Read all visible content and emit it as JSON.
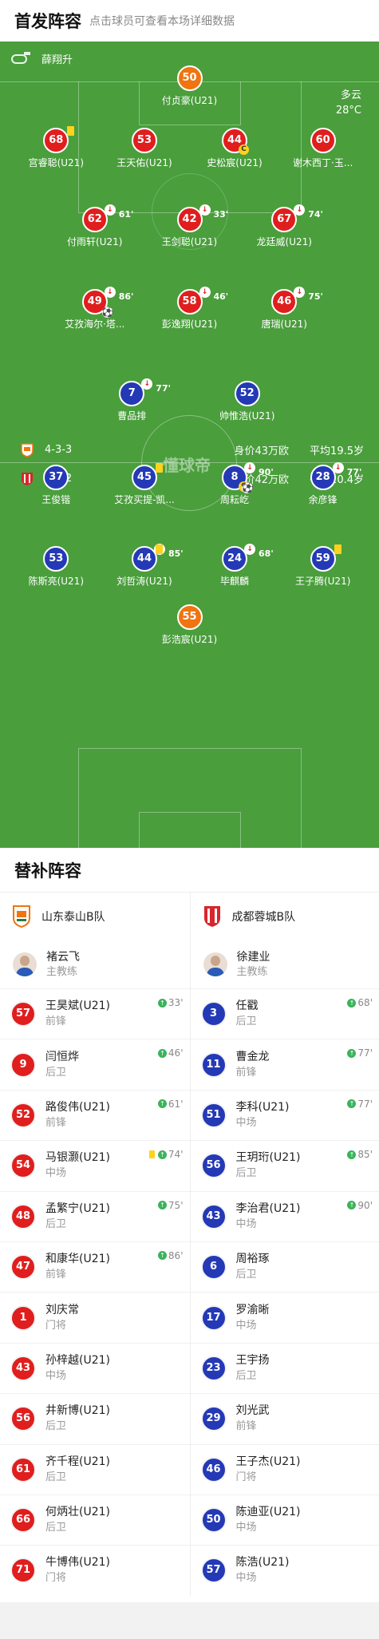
{
  "starting": {
    "title": "首发阵容",
    "hint": "点击球员可查看本场详细数据"
  },
  "pitch": {
    "referee": "薛翔升",
    "weather": "多云",
    "temperature": "28°C",
    "home": {
      "formation": "4-3-3",
      "value": "身价43万欧",
      "age": "平均19.5岁"
    },
    "away": {
      "formation": "4-4-2",
      "value": "身价42万欧",
      "age": "平均20.4岁"
    },
    "players": [
      {
        "num": "50",
        "name": "付贞豪(U21)",
        "color": "orange",
        "row": 0,
        "col": 0.5
      },
      {
        "num": "68",
        "name": "宫睿聪(U21)",
        "color": "red",
        "row": 1,
        "col": 0.148,
        "yellow": true
      },
      {
        "num": "53",
        "name": "王天佑(U21)",
        "color": "red",
        "row": 1,
        "col": 0.381
      },
      {
        "num": "44",
        "name": "史松宸(U21)",
        "color": "red",
        "row": 1,
        "col": 0.619,
        "captain": true
      },
      {
        "num": "60",
        "name": "谢木西丁·玉...",
        "color": "red",
        "row": 1,
        "col": 0.852
      },
      {
        "num": "62",
        "name": "付雨轩(U21)",
        "color": "red",
        "row": 2,
        "col": 0.25,
        "sub": "61'"
      },
      {
        "num": "42",
        "name": "王剑聪(U21)",
        "color": "red",
        "row": 2,
        "col": 0.5,
        "sub": "33'"
      },
      {
        "num": "67",
        "name": "龙廷威(U21)",
        "color": "red",
        "row": 2,
        "col": 0.75,
        "sub": "74'"
      },
      {
        "num": "49",
        "name": "艾孜海尔·塔...",
        "color": "red",
        "row": 3,
        "col": 0.25,
        "sub": "86'",
        "goal": true
      },
      {
        "num": "58",
        "name": "彭逸翔(U21)",
        "color": "red",
        "row": 3,
        "col": 0.5,
        "sub": "46'"
      },
      {
        "num": "46",
        "name": "唐瑞(U21)",
        "color": "red",
        "row": 3,
        "col": 0.75,
        "sub": "75'"
      },
      {
        "num": "7",
        "name": "曹品排",
        "color": "blue",
        "row": 4,
        "col": 0.348,
        "sub": "77'"
      },
      {
        "num": "52",
        "name": "帅惟浩(U21)",
        "color": "blue",
        "row": 4,
        "col": 0.652
      },
      {
        "num": "37",
        "name": "王俊锴",
        "color": "blue",
        "row": 5,
        "col": 0.148
      },
      {
        "num": "45",
        "name": "艾孜买提-凯...",
        "color": "blue",
        "row": 5,
        "col": 0.381,
        "yellow": true
      },
      {
        "num": "8",
        "name": "周耘屹",
        "color": "blue",
        "row": 5,
        "col": 0.619,
        "sub": "90'",
        "captain": true,
        "goal": true
      },
      {
        "num": "28",
        "name": "余彦锋",
        "color": "blue",
        "row": 5,
        "col": 0.852,
        "sub": "77'"
      },
      {
        "num": "53",
        "name": "陈斯亮(U21)",
        "color": "blue",
        "row": 6,
        "col": 0.148
      },
      {
        "num": "44",
        "name": "刘哲涛(U21)",
        "color": "blue",
        "row": 6,
        "col": 0.381,
        "sub": "85'",
        "yellow": true
      },
      {
        "num": "24",
        "name": "毕麒麟",
        "color": "blue",
        "row": 6,
        "col": 0.619,
        "sub": "68'"
      },
      {
        "num": "59",
        "name": "王子腾(U21)",
        "color": "blue",
        "row": 6,
        "col": 0.852,
        "yellow": true
      },
      {
        "num": "55",
        "name": "彭浩宸(U21)",
        "color": "orange",
        "row": 7,
        "col": 0.5
      }
    ]
  },
  "subs": {
    "title": "替补阵容",
    "coach_label": "主教练",
    "home": {
      "team": "山东泰山B队",
      "coach": "褚云飞",
      "players": [
        {
          "num": "57",
          "name": "王昊斌(U21)",
          "pos": "前锋",
          "in": "33'"
        },
        {
          "num": "9",
          "name": "闫恒烨",
          "pos": "后卫",
          "in": "46'"
        },
        {
          "num": "52",
          "name": "路俊伟(U21)",
          "pos": "前锋",
          "in": "61'"
        },
        {
          "num": "54",
          "name": "马银灏(U21)",
          "pos": "中场",
          "in": "74'",
          "yellow": true
        },
        {
          "num": "48",
          "name": "孟繁宁(U21)",
          "pos": "后卫",
          "in": "75'"
        },
        {
          "num": "47",
          "name": "和康华(U21)",
          "pos": "前锋",
          "in": "86'"
        },
        {
          "num": "1",
          "name": "刘庆常",
          "pos": "门将"
        },
        {
          "num": "43",
          "name": "孙梓越(U21)",
          "pos": "中场"
        },
        {
          "num": "56",
          "name": "井新博(U21)",
          "pos": "后卫"
        },
        {
          "num": "61",
          "name": "齐千程(U21)",
          "pos": "后卫"
        },
        {
          "num": "66",
          "name": "何炳壮(U21)",
          "pos": "后卫"
        },
        {
          "num": "71",
          "name": "牛博伟(U21)",
          "pos": "门将"
        }
      ]
    },
    "away": {
      "team": "成都蓉城B队",
      "coach": "徐建业",
      "players": [
        {
          "num": "3",
          "name": "任戳",
          "pos": "后卫",
          "in": "68'"
        },
        {
          "num": "11",
          "name": "曹金龙",
          "pos": "前锋",
          "in": "77'"
        },
        {
          "num": "51",
          "name": "李科(U21)",
          "pos": "中场",
          "in": "77'"
        },
        {
          "num": "56",
          "name": "王玥珩(U21)",
          "pos": "后卫",
          "in": "85'"
        },
        {
          "num": "43",
          "name": "李治君(U21)",
          "pos": "中场",
          "in": "90'"
        },
        {
          "num": "6",
          "name": "周裕琢",
          "pos": "后卫"
        },
        {
          "num": "17",
          "name": "罗渝晰",
          "pos": "中场"
        },
        {
          "num": "23",
          "name": "王宇扬",
          "pos": "后卫"
        },
        {
          "num": "29",
          "name": "刘光武",
          "pos": "前锋"
        },
        {
          "num": "46",
          "name": "王子杰(U21)",
          "pos": "门将"
        },
        {
          "num": "50",
          "name": "陈迪亚(U21)",
          "pos": "中场"
        },
        {
          "num": "57",
          "name": "陈浩(U21)",
          "pos": "中场"
        }
      ]
    }
  }
}
